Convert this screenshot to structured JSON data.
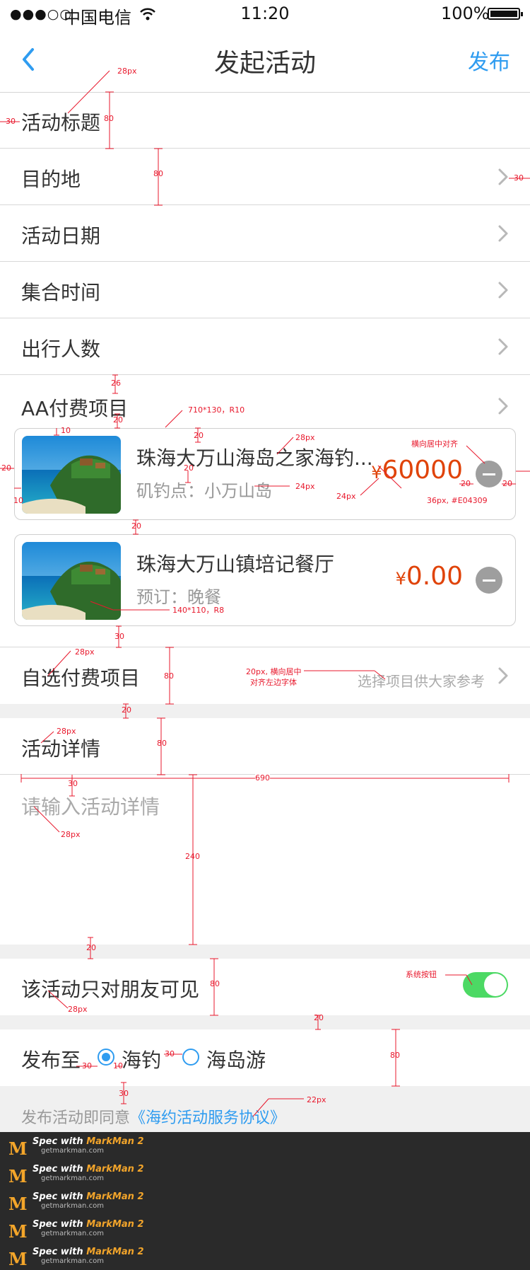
{
  "status_bar": {
    "signal": "●●●○○",
    "carrier": "中国电信",
    "time": "11:20",
    "battery": "100%"
  },
  "nav": {
    "title": "发起活动",
    "publish": "发布"
  },
  "form": {
    "activity_title": "活动标题",
    "destination": "目的地",
    "activity_date": "活动日期",
    "gather_time": "集合时间",
    "people_count": "出行人数",
    "aa_items": "AA付费项目"
  },
  "items": [
    {
      "name": "珠海大万山海岛之家海钓...",
      "sub": "矶钓点：小万山岛",
      "currency": "¥",
      "price": "60000"
    },
    {
      "name": "珠海大万山镇培记餐厅",
      "sub": "预订：晚餐",
      "currency": "¥",
      "price": "0.00"
    }
  ],
  "optional": {
    "label": "自选付费项目",
    "hint": "选择项目供大家参考"
  },
  "details": {
    "label": "活动详情",
    "placeholder": "请输入活动详情"
  },
  "friends_only": {
    "label": "该活动只对朋友可见",
    "enabled": true
  },
  "publish_to": {
    "label": "发布至",
    "options": [
      {
        "label": "海钓",
        "checked": true
      },
      {
        "label": "海岛游",
        "checked": false
      }
    ]
  },
  "agreement": {
    "prefix": "发布活动即同意",
    "link": "《海约活动服务协议》"
  },
  "annotations": {
    "a28_title": "28px",
    "a30_left": "30",
    "a80_row1": "80",
    "a80_row2": "80",
    "a30_right": "30",
    "a26": "26",
    "a20_a": "20",
    "a710": "710*130，R10",
    "a10_a": "10",
    "a20_b": "20",
    "a28_name": "28px",
    "a20_c": "20",
    "a24_sub": "24px",
    "a20_left": "20",
    "a10_b": "10",
    "a_center": "横向居中对齐",
    "a24_yen": "24px",
    "a36": "36px, #E04309",
    "a20_m1": "20",
    "a20_m2": "20",
    "a20_d": "20",
    "a140": "140*110，R8",
    "a30_c": "30",
    "a28_opt": "28px",
    "a80_opt": "80",
    "a20_hint1": "20px, 横向居中",
    "a20_hint2": "对齐左边字体",
    "a20_e": "20",
    "a28_det": "28px",
    "a80_det": "80",
    "a30_d": "30",
    "a690": "690",
    "a240": "240",
    "a28_ph": "28px",
    "a20_f": "20",
    "a80_friend": "80",
    "a_sys": "系统按钮",
    "a28_friend": "28px",
    "a20_g": "20",
    "a30_r1": "30",
    "a10_r": "10",
    "a30_r2": "30",
    "a80_pub": "80",
    "a30_e": "30",
    "a22": "22px"
  },
  "watermark": {
    "spec": "Spec with",
    "brand": "MarkMan 2",
    "site": "getmarkman.com",
    "count": 5
  },
  "colors": {
    "accent": "#2f9cf0",
    "price": "#e04309",
    "toggle": "#4cd964",
    "annotation": "#e8182c"
  },
  "icons": [
    "back-chevron-icon",
    "chevron-right-icon",
    "minus-circle-icon",
    "wifi-icon",
    "battery-icon",
    "markman-logo"
  ]
}
